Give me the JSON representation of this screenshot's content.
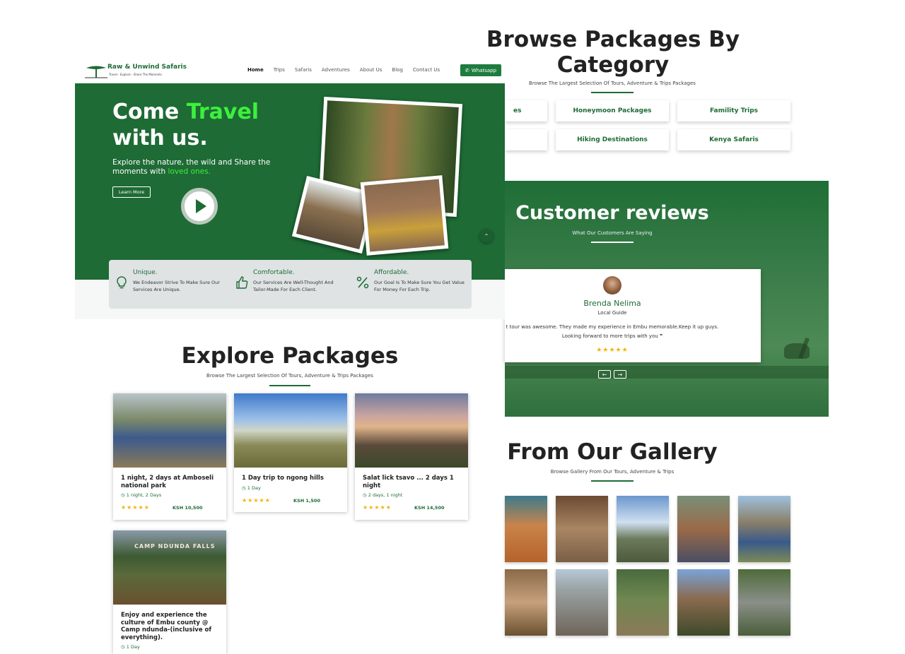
{
  "site": {
    "logo": {
      "name": "Raw & Unwind Safaris",
      "tagline": "Travel - Explore - Share The Moments"
    },
    "nav": [
      "Home",
      "Trips",
      "Safaris",
      "Adventures",
      "About Us",
      "Blog",
      "Contact Us"
    ],
    "whatsapp_label": "Whatsapp"
  },
  "hero": {
    "title_pre": "Come ",
    "title_highlight": "Travel",
    "title_post": "with us.",
    "desc": "Explore the nature, the wild and Share the moments with ",
    "desc_highlight": "loved ones.",
    "learn_more": "Learn More"
  },
  "features": [
    {
      "title": "Unique.",
      "text": "We Endeavor Strive To Make Sure Our Services Are Unique.",
      "icon": "lightbulb-icon"
    },
    {
      "title": "Comfortable.",
      "text": "Our Services Are Well-Thought And Tailor-Made For Each Client.",
      "icon": "thumbs-up-icon"
    },
    {
      "title": "Affordable.",
      "text": "Our Goal Is To Make Sure You Get Value For Money For Each Trip.",
      "icon": "percent-icon"
    }
  ],
  "explore": {
    "title": "Explore Packages",
    "subtitle": "Browse The Largest Selection Of Tours, Adventure & Trips Packages",
    "packages": [
      {
        "title": "1 night, 2 days at Amboseli national park",
        "duration": "1 night, 2 Days",
        "price": "KSH 10,500",
        "stars": "★★★★★"
      },
      {
        "title": "1 Day trip to ngong hills",
        "duration": "1 Day",
        "price": "KSH 1,500",
        "stars": "★★★★★"
      },
      {
        "title": "Salat lick tsavo ... 2 days 1 night",
        "duration": "2 days, 1 night",
        "price": "KSH 14,500",
        "stars": "★★★★★"
      },
      {
        "title": "Enjoy and experience the culture of Embu county @ Camp ndunda-(inclusive of everything).",
        "duration": "1 Day"
      }
    ],
    "sign_text": "CAMP NDUNDA FALLS"
  },
  "browse": {
    "title": "Browse Packages By Category",
    "subtitle": "Browse The Largest Selection Of Tours, Adventure & Trips Packages",
    "categories": [
      "es",
      "Honeymoon Packages",
      "Famility Trips",
      "Hiking Destinations",
      "Kenya Safaris"
    ]
  },
  "reviews": {
    "title": "Customer reviews",
    "subtitle": "What Our Customers Are Saying",
    "name": "Brenda Nelima",
    "role": "Local Guide",
    "text": "t tour was awesome. They made my experience in Embu memorable.Keep it up guys. Looking forward to more trips with you",
    "quote_mark": "❞",
    "stars": "★★★★★",
    "prev": "←",
    "next": "→"
  },
  "gallery": {
    "title": "From Our Gallery",
    "subtitle": "Browse Gallery From Our Tours, Adventure & Trips"
  },
  "colors": {
    "brand_green": "#1e6b35",
    "highlight_green": "#3df03d",
    "star": "#f3b300"
  }
}
